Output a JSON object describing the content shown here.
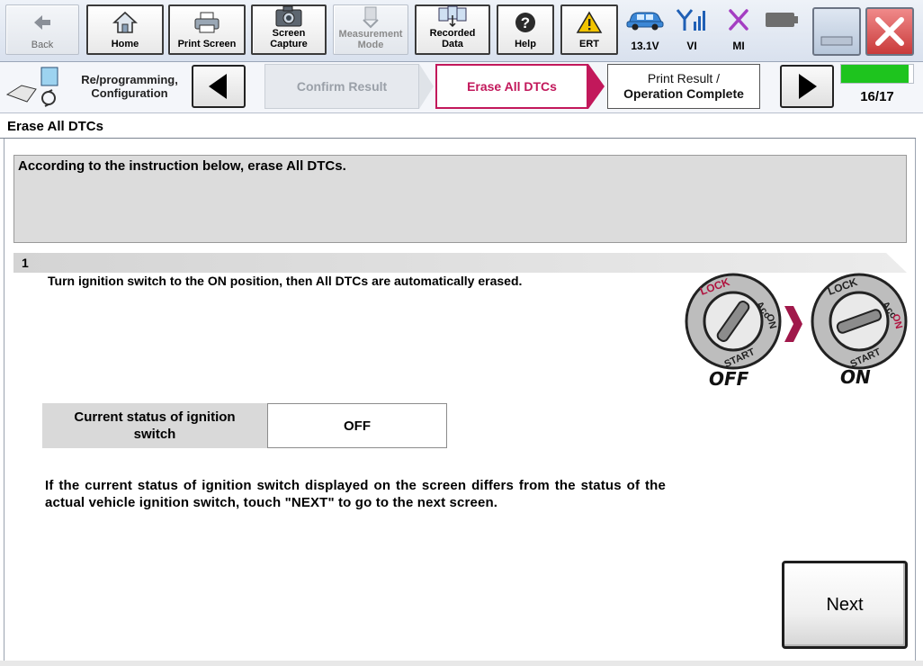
{
  "toolbar": {
    "back_label": "Back",
    "home_label": "Home",
    "print_screen_label": "Print Screen",
    "screen_capture_label_1": "Screen",
    "screen_capture_label_2": "Capture",
    "measurement_mode_label_1": "Measurement",
    "measurement_mode_label_2": "Mode",
    "recorded_data_label_1": "Recorded",
    "recorded_data_label_2": "Data",
    "help_label": "Help",
    "ert_label": "ERT",
    "status": {
      "voltage": "13.1V",
      "vi_label": "VI",
      "mi_label": "MI"
    }
  },
  "nav": {
    "section_title_1": "Re/programming,",
    "section_title_2": "Configuration",
    "steps": {
      "prev": "Confirm Result",
      "current": "Erase All DTCs",
      "next_1": "Print Result /",
      "next_2": "Operation Complete"
    },
    "progress_text": "16/17",
    "progress_fraction": 0.94
  },
  "page": {
    "title": "Erase All DTCs",
    "instruction": "According to the instruction below, erase All DTCs.",
    "step_number": "1",
    "step_text": "Turn ignition switch to the ON position, then All DTCs are automatically erased.",
    "ignition_status_label_1": "Current status of ignition",
    "ignition_status_label_2": "switch",
    "ignition_status_value": "OFF",
    "note": "If the current status of ignition switch displayed on the screen differs from the status of the actual vehicle ignition switch, touch \"NEXT\" to go to the next screen.",
    "next_button": "Next"
  },
  "figure": {
    "off_caption": "OFF",
    "on_caption": "ON",
    "lock_label": "LOCK",
    "acc_label": "Acc",
    "on_label": "ON",
    "start_label": "START"
  },
  "colors": {
    "current_step": "#c2185b",
    "progress_green": "#1ec41e",
    "close_red": "#d9534f",
    "arrow_magenta": "#a0184a"
  }
}
